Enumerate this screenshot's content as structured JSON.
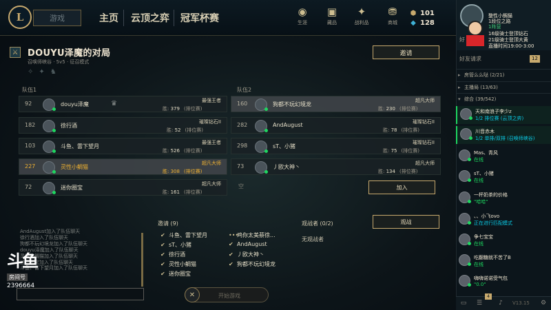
{
  "topbar": {
    "logo": "L",
    "play_button": "游戏",
    "nav": [
      "主页",
      "云顶之弈",
      "冠军杯赛"
    ],
    "icons": [
      {
        "name": "profile-icon",
        "glyph": "◉",
        "label": "生涯"
      },
      {
        "name": "collection-icon",
        "glyph": "▣",
        "label": "藏品"
      },
      {
        "name": "loot-icon",
        "glyph": "✦",
        "label": "战利品"
      },
      {
        "name": "store-icon",
        "glyph": "⛃",
        "label": "商城"
      }
    ],
    "currency": {
      "rp": "101",
      "be": "128"
    }
  },
  "lobby": {
    "title": "DOUYU泽魔的对局",
    "subtitle": "召唤师峡谷 · 5v5 · 征召模式",
    "invite_button": "邀请",
    "team1_label": "队伍1",
    "team2_label": "队伍2",
    "win_label": "胜:",
    "queue_label": "(排位赛)",
    "team1": [
      {
        "level": "92",
        "name": "douyu泽魔",
        "rank": "最强王者",
        "wins": "379"
      },
      {
        "level": "182",
        "name": "徐行酒",
        "rank": "璀璨钻石II",
        "wins": "52"
      },
      {
        "level": "103",
        "name": "斗鱼、雷下望月",
        "rank": "最强王者",
        "wins": "526"
      },
      {
        "level": "227",
        "name": "灵性小鲷猫",
        "rank": "超凡大师",
        "wins": "308"
      },
      {
        "level": "72",
        "name": "迷你圈宝",
        "rank": "超凡大师",
        "wins": "161"
      }
    ],
    "team2": [
      {
        "level": "160",
        "name": "狗都不玩幻境龙",
        "rank": "超凡大师",
        "wins": "230"
      },
      {
        "level": "282",
        "name": "AndAugust",
        "rank": "璀璨钻石II",
        "wins": "78"
      },
      {
        "level": "298",
        "name": "sT、小猪",
        "rank": "璀璨钻石II",
        "wins": "75"
      },
      {
        "level": "73",
        "name": "丿欧大神丶",
        "rank": "超凡大师",
        "wins": "134"
      }
    ],
    "empty_slot": "空",
    "join_button": "加入",
    "invites_label": "邀请 (9)",
    "invites_col1": [
      "斗鱼、雷下望月",
      "sT、小猪",
      "徐行酒",
      "灵性小鲷猫",
      "迷你圈宝"
    ],
    "invites_col2": [
      "鸡你太美蔡徐...",
      "AndAugust",
      "丿欧大神丶",
      "狗都不玩幻境龙"
    ],
    "spectators_label": "观战者 (0/2)",
    "no_spectators": "无观战者",
    "watch_button": "观战",
    "start_button": "开始游戏",
    "chat_log": [
      "AndAugust加入了队伍聊天",
      "徐行酒加入了队伍聊天",
      "狗都不玩幻境龙加入了队伍聊天",
      "douyu泽魔加入了队伍聊天",
      "灵性小鲷猫加入了队伍聊天",
      "迷你圈宝加入了队伍聊天",
      "斗鱼、雷下望月加入了队伍聊天"
    ]
  },
  "watermark": {
    "logo": "斗鱼",
    "label": "房间号",
    "room": "2396664"
  },
  "sidebar": {
    "profile_lines": [
      "整性小鲷猫",
      "1段位之路",
      "1阵营",
      "16级骑士登顶钻石",
      "21级骑士登顶大黄",
      "直播时间19:00-3:00"
    ],
    "friends_label": "好",
    "friend_request": "好友请求",
    "friend_request_count": "12",
    "groups": [
      {
        "label": "房管么么哒 (2/21)",
        "arrow": "▸"
      },
      {
        "label": "主播局 (13/63)",
        "arrow": "▸"
      },
      {
        "label": "综合 (39/542)",
        "arrow": "▾"
      }
    ],
    "friends": [
      {
        "name": "天和南浪子李少z",
        "status": "1/2 排位赛 (云顶之弈)",
        "active": true
      },
      {
        "name": "川音赤木",
        "status": "1/2 单排/双排 (召唤师峡谷)",
        "active": true
      },
      {
        "name": "Mas、青风",
        "status": "在线",
        "active": false
      },
      {
        "name": "sT、小猪",
        "status": "在线",
        "active": false
      },
      {
        "name": "一杯奶茶的价格",
        "status": "\"哈哈\"",
        "active": false
      },
      {
        "name": "、、小飞ovo",
        "status": "正在进行匹配模式",
        "active": false
      },
      {
        "name": "争七宝宝",
        "status": "在线",
        "active": false
      },
      {
        "name": "吃翻糖就不苦了B",
        "status": "在线",
        "active": false
      },
      {
        "name": "嗨嗨诺诺受气包",
        "status": "\"0.0\"",
        "active": false
      }
    ],
    "version": "V13.15",
    "bottom_badge": "4"
  },
  "colors": {
    "gold": "#c8aa6e",
    "online": "#1ed760",
    "bg": "#010a13"
  }
}
